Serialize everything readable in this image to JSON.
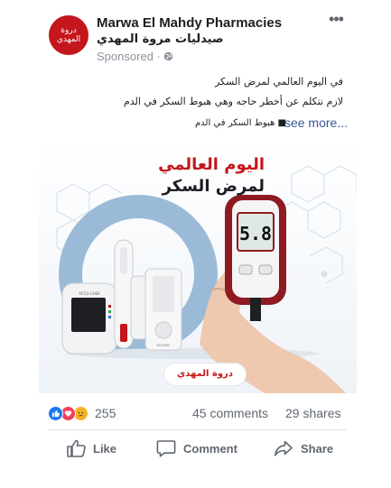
{
  "post": {
    "page_name": "Marwa El Mahdy Pharmacies",
    "page_name_ar": "صيدليات مروة المهدي",
    "sponsored": "Sponsored · ",
    "avatar_text": "دروة المهدي",
    "text_lines": [
      "في اليوم العالمي لمرض السكر",
      "لازم نتكلم عن أخطر حاجه وهي هبوط السكر في الدم"
    ],
    "teaser": "■ هبوط السكر في الدم",
    "see_more": "see more..."
  },
  "ad_image": {
    "title": "اليوم العالمي",
    "subtitle": "لمرض السكر",
    "logo_text": "دروة المهدي",
    "meter_reading": "5.8",
    "strip_brand": "ACCU-CHEK"
  },
  "engagement": {
    "reaction_count": "255",
    "comments": "45 comments",
    "shares": "29 shares"
  },
  "actions": {
    "like": "Like",
    "comment": "Comment",
    "share": "Share"
  },
  "colors": {
    "brand_red": "#c4161c",
    "link_blue": "#385898",
    "like_blue": "#1877f2",
    "love_red": "#f33e58",
    "sad_yellow": "#f7b125"
  }
}
